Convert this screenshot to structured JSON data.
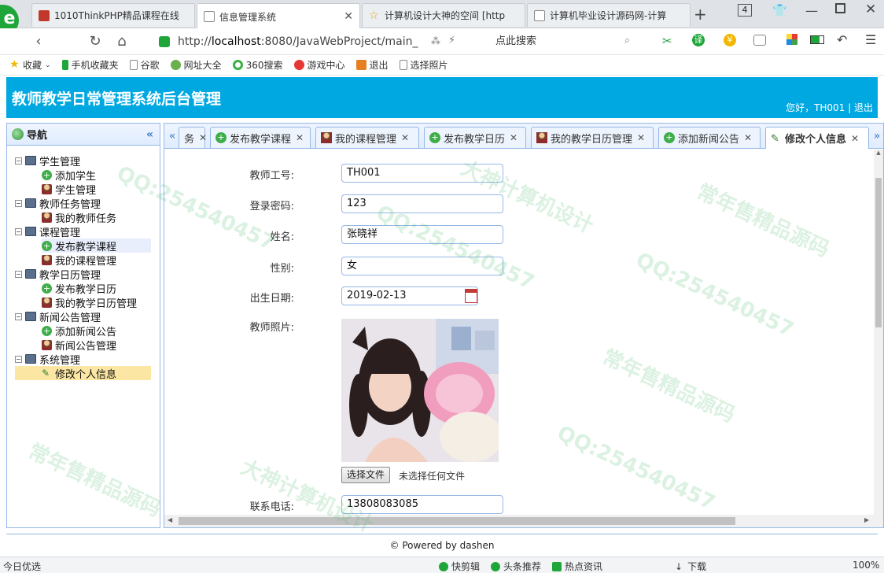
{
  "browser": {
    "tabs": [
      {
        "label": "1010ThinkPHP精品课程在线",
        "active": false
      },
      {
        "label": "信息管理系统",
        "active": true
      },
      {
        "label": "计算机设计大神的空间 [http",
        "active": false
      },
      {
        "label": "计算机毕业设计源码网-计算",
        "active": false
      }
    ],
    "tab_count": "4",
    "url_prefix": "http://",
    "url_host": "localhost",
    "url_rest": ":8080/JavaWebProject/main_",
    "search_placeholder": "点此搜索",
    "bookmarks": [
      "收藏",
      "手机收藏夹",
      "谷歌",
      "网址大全",
      "360搜索",
      "游戏中心",
      "退出",
      "选择照片"
    ]
  },
  "app": {
    "title": "教师教学日常管理系统后台管理",
    "greeting": "您好，TH001 | 退出"
  },
  "nav": {
    "title": "导航",
    "tree": [
      {
        "label": "学生管理",
        "type": "group"
      },
      {
        "label": "添加学生",
        "type": "add"
      },
      {
        "label": "学生管理",
        "type": "user"
      },
      {
        "label": "教师任务管理",
        "type": "group"
      },
      {
        "label": "我的教师任务",
        "type": "user"
      },
      {
        "label": "课程管理",
        "type": "group"
      },
      {
        "label": "发布教学课程",
        "type": "add"
      },
      {
        "label": "我的课程管理",
        "type": "user"
      },
      {
        "label": "教学日历管理",
        "type": "group"
      },
      {
        "label": "发布教学日历",
        "type": "add"
      },
      {
        "label": "我的教学日历管理",
        "type": "user"
      },
      {
        "label": "新闻公告管理",
        "type": "group"
      },
      {
        "label": "添加新闻公告",
        "type": "add"
      },
      {
        "label": "新闻公告管理",
        "type": "user"
      },
      {
        "label": "系统管理",
        "type": "group"
      },
      {
        "label": "修改个人信息",
        "type": "edit"
      }
    ]
  },
  "tabs": [
    {
      "label": "务"
    },
    {
      "label": "发布教学课程"
    },
    {
      "label": "我的课程管理"
    },
    {
      "label": "发布教学日历"
    },
    {
      "label": "我的教学日历管理"
    },
    {
      "label": "添加新闻公告"
    },
    {
      "label": "修改个人信息"
    }
  ],
  "form": {
    "teacher_id_label": "教师工号:",
    "teacher_id": "TH001",
    "password_label": "登录密码:",
    "password": "123",
    "name_label": "姓名:",
    "name": "张晓祥",
    "gender_label": "性别:",
    "gender": "女",
    "birth_label": "出生日期:",
    "birth": "2019-02-13",
    "photo_label": "教师照片:",
    "file_button": "选择文件",
    "file_status": "未选择任何文件",
    "phone_label": "联系电话:",
    "phone": "13808083085"
  },
  "footer": "© Powered by dashen",
  "statusbar": {
    "left": "今日优选",
    "items": [
      "快剪辑",
      "头条推荐",
      "热点资讯",
      "下载"
    ],
    "zoom": "100%"
  },
  "watermark": {
    "qq": "QQ:254540457",
    "shop": "常年售精品源码",
    "design": "大神计算机设计"
  },
  "colors": {
    "header": "#00a8e1",
    "border": "#95b8e7",
    "selected": "#fbe7a3"
  }
}
